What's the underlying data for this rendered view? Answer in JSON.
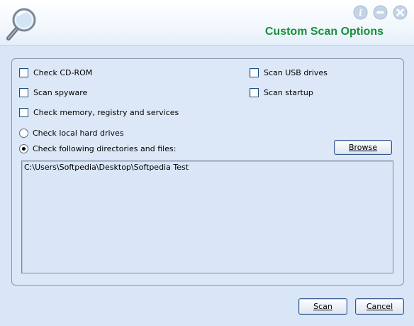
{
  "header": {
    "title": "Custom Scan Options"
  },
  "window_buttons": [
    {
      "name": "info-icon",
      "color": "#b9c9de"
    },
    {
      "name": "minimize-icon",
      "color": "#b9c9de"
    },
    {
      "name": "close-icon",
      "color": "#b9c9de"
    }
  ],
  "options": {
    "cd_rom": {
      "label": "Check CD-ROM",
      "checked": false
    },
    "usb": {
      "label": "Scan USB drives",
      "checked": false
    },
    "spyware": {
      "label": "Scan spyware",
      "checked": false
    },
    "startup": {
      "label": "Scan startup",
      "checked": false
    },
    "memory": {
      "label": "Check memory, registry and services",
      "checked": false
    }
  },
  "scan_target": {
    "local": {
      "label": "Check local hard drives",
      "selected": false
    },
    "following": {
      "label": "Check following directories and files:",
      "selected": true
    }
  },
  "browse_label": "Browse",
  "paths": [
    "C:\\Users\\Softpedia\\Desktop\\Softpedia Test"
  ],
  "buttons": {
    "scan": "Scan",
    "cancel": "Cancel"
  },
  "colors": {
    "title": "#17913a",
    "background": "#d9e6f7"
  }
}
